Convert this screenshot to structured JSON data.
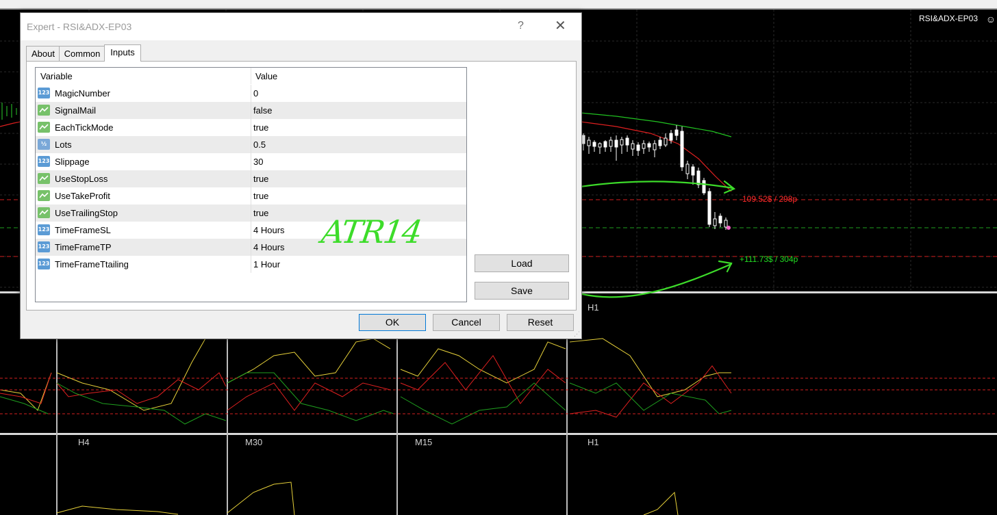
{
  "window": {
    "title": "Expert - RSI&ADX-EP03",
    "help_label": "?",
    "close_label": "✕"
  },
  "tabs": [
    {
      "label": "About"
    },
    {
      "label": "Common"
    },
    {
      "label": "Inputs"
    }
  ],
  "active_tab": "Inputs",
  "table": {
    "headers": {
      "variable": "Variable",
      "value": "Value"
    },
    "rows": [
      {
        "icon": "integer-icon",
        "badge": "123",
        "variable": "MagicNumber",
        "value": "0"
      },
      {
        "icon": "boolean-icon",
        "badge": "",
        "variable": "SignalMail",
        "value": "false"
      },
      {
        "icon": "boolean-icon",
        "badge": "",
        "variable": "EachTickMode",
        "value": "true"
      },
      {
        "icon": "double-icon",
        "badge": "½",
        "variable": "Lots",
        "value": "0.5"
      },
      {
        "icon": "integer-icon",
        "badge": "123",
        "variable": "Slippage",
        "value": "30"
      },
      {
        "icon": "boolean-icon",
        "badge": "",
        "variable": "UseStopLoss",
        "value": "true"
      },
      {
        "icon": "boolean-icon",
        "badge": "",
        "variable": "UseTakeProfit",
        "value": "true"
      },
      {
        "icon": "boolean-icon",
        "badge": "",
        "variable": "UseTrailingStop",
        "value": "true"
      },
      {
        "icon": "integer-icon",
        "badge": "123",
        "variable": "TimeFrameSL",
        "value": "4 Hours"
      },
      {
        "icon": "integer-icon",
        "badge": "123",
        "variable": "TimeFrameTP",
        "value": "4 Hours"
      },
      {
        "icon": "integer-icon",
        "badge": "123",
        "variable": "TimeFrameTtailing",
        "value": "1 Hour"
      }
    ]
  },
  "buttons": {
    "load": "Load",
    "save": "Save",
    "ok": "OK",
    "cancel": "Cancel",
    "reset": "Reset"
  },
  "chart": {
    "ea_name": "RSI&ADX-EP03",
    "smiley": "☺",
    "sl_label": "-109.52$ / 298p",
    "tp_label": "+111.73$ / 304p",
    "timeframes_middle": [
      "H1"
    ],
    "timeframes_bottom": [
      "H4",
      "M30",
      "M15",
      "H1"
    ],
    "colors": {
      "sl": "#ff2a2a",
      "tp": "#22dd22",
      "annotation": "#3ddc2a"
    }
  },
  "annotation": {
    "text": "ATR14"
  }
}
